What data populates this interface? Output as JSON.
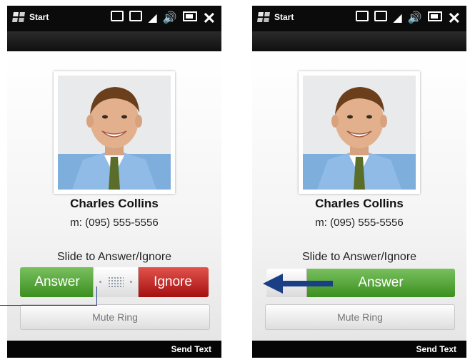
{
  "left_screen": {
    "start_label": "Start",
    "caller_name": "Charles Collins",
    "caller_phone": "m: (095) 555-5556",
    "slide_label": "Slide to Answer/Ignore",
    "answer_label": "Answer",
    "ignore_label": "Ignore",
    "mute_label": "Mute Ring",
    "send_text_label": "Send Text"
  },
  "right_screen": {
    "start_label": "Start",
    "caller_name": "Charles Collins",
    "caller_phone": "m: (095) 555-5556",
    "slide_label": "Slide to Answer/Ignore",
    "answer_label": "Answer",
    "mute_label": "Mute Ring",
    "send_text_label": "Send Text"
  },
  "status_icons": [
    "tv-icon",
    "data-icon",
    "signal-icon",
    "speaker-icon",
    "battery-icon",
    "close-icon"
  ],
  "colors": {
    "answer_green": "#4da52c",
    "ignore_red": "#c4201d",
    "callout_blue": "#1b3f85"
  }
}
